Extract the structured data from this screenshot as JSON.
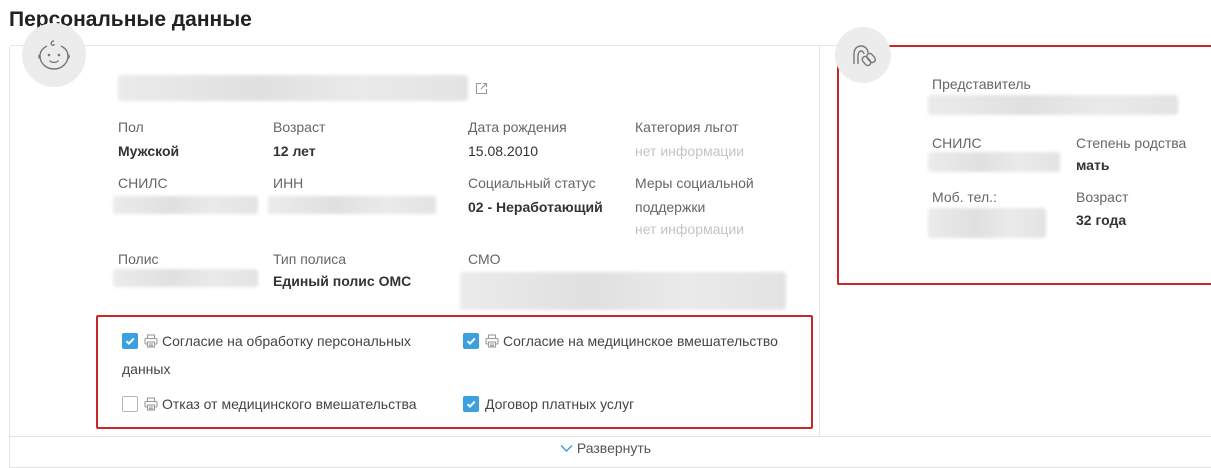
{
  "page": {
    "title": "Персональные данные"
  },
  "patient": {
    "gender_label": "Пол",
    "gender_value": "Мужской",
    "age_label": "Возраст",
    "age_value": "12 лет",
    "birthdate_label": "Дата рождения",
    "birthdate_value": "15.08.2010",
    "benefit_label": "Категория льгот",
    "benefit_value": "нет информации",
    "snils_label": "СНИЛС",
    "inn_label": "ИНН",
    "social_status_label": "Социальный статус",
    "social_status_value": "02 - Неработающий",
    "social_support_label_1": "Меры социальной",
    "social_support_label_2": "поддержки",
    "social_support_value": "нет информации",
    "policy_label": "Полис",
    "policy_type_label": "Тип полиса",
    "policy_type_value": "Единый полис ОМС",
    "smo_label": "СМО"
  },
  "consents": {
    "items": [
      {
        "label_line1": "Согласие на обработку персональных",
        "label_line2": "данных",
        "checked": true,
        "printable": true
      },
      {
        "label": "Согласие на медицинское вмешательство",
        "checked": true,
        "printable": true
      },
      {
        "label": "Отказ от медицинского вмешательства",
        "checked": false,
        "printable": true
      },
      {
        "label": "Договор платных услуг",
        "checked": true,
        "printable": false
      }
    ]
  },
  "representative": {
    "title": "Представитель",
    "snils_label": "СНИЛС",
    "relation_label": "Степень родства",
    "relation_value": "мать",
    "phone_label": "Моб. тел.:",
    "age_label": "Возраст",
    "age_value": "32 года"
  },
  "footer": {
    "expand_label": "Развернуть"
  },
  "colors": {
    "accent": "#3aa0e0",
    "highlight": "#c62828",
    "muted": "#c4c4c4"
  }
}
